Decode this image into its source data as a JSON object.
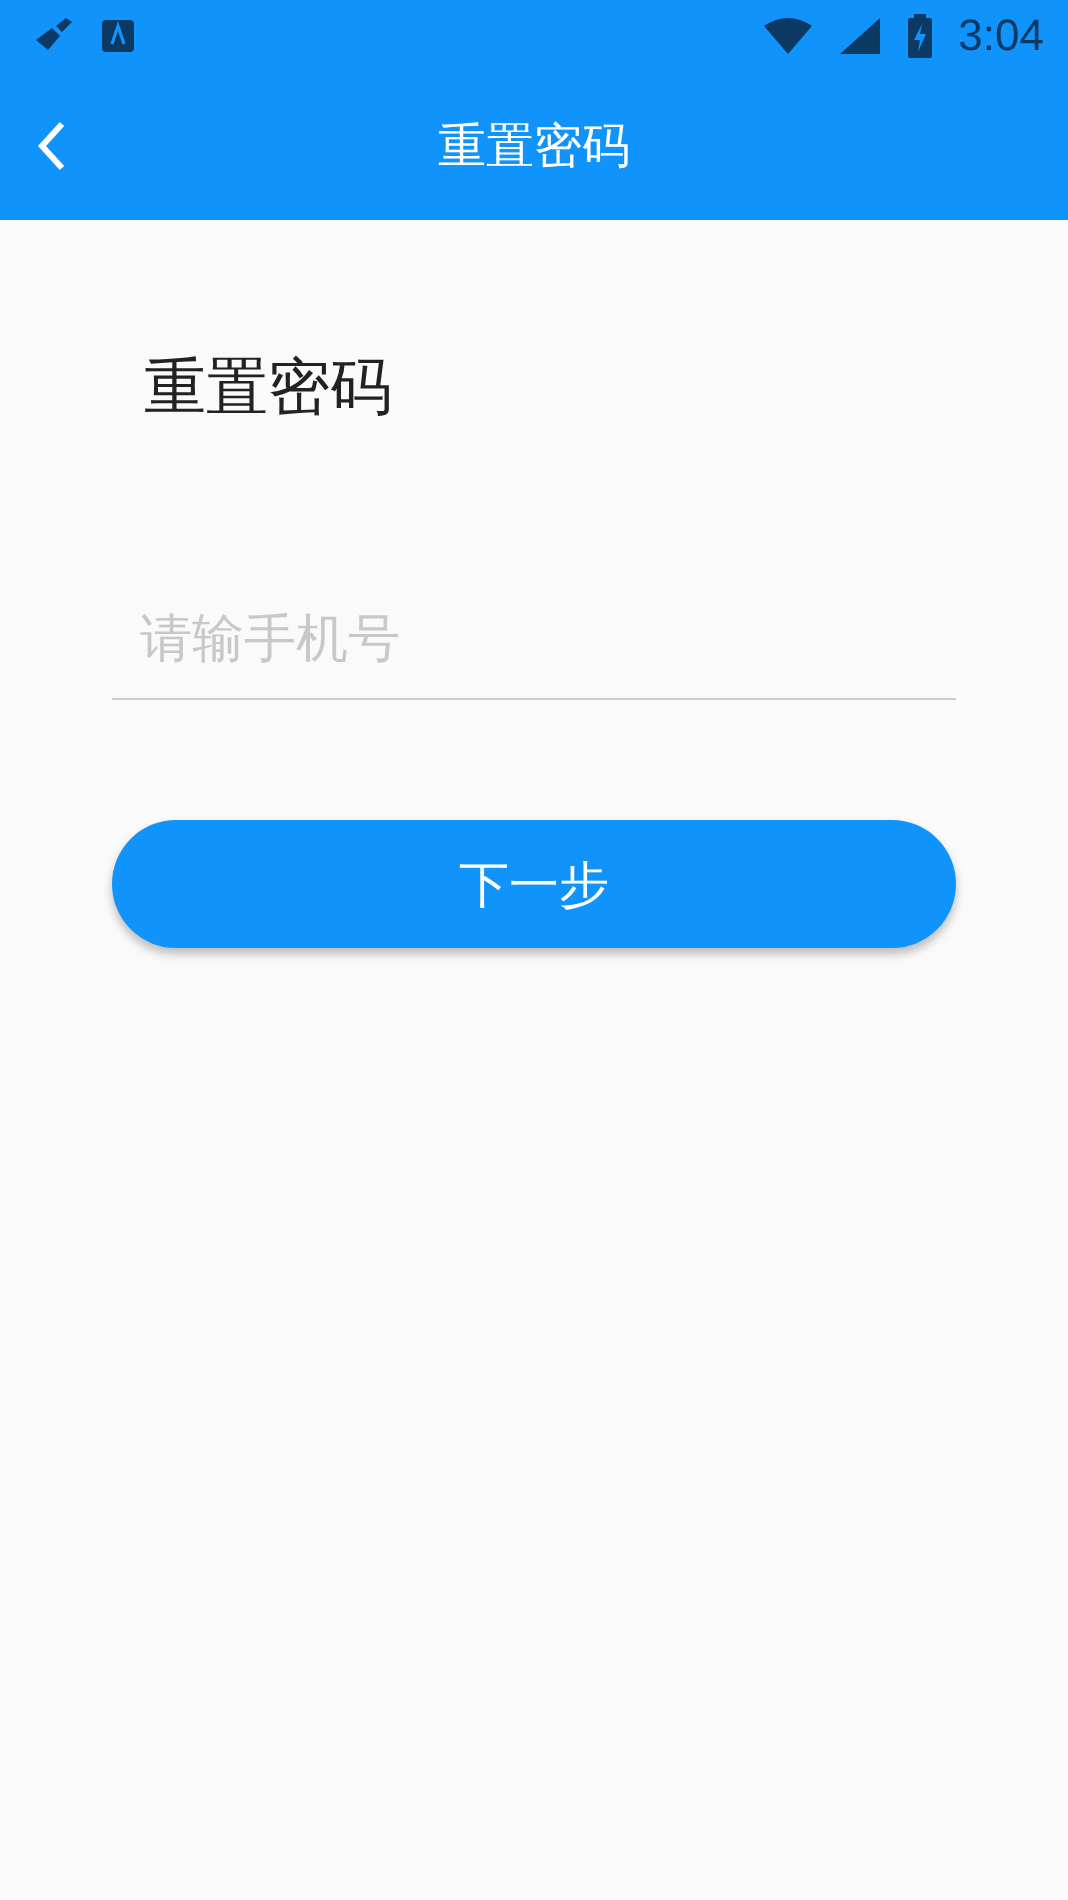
{
  "status_bar": {
    "time": "3:04"
  },
  "app_bar": {
    "title": "重置密码"
  },
  "heading": "重置密码",
  "phone_field": {
    "placeholder": "请输手机号"
  },
  "buttons": [
    "下一步"
  ]
}
